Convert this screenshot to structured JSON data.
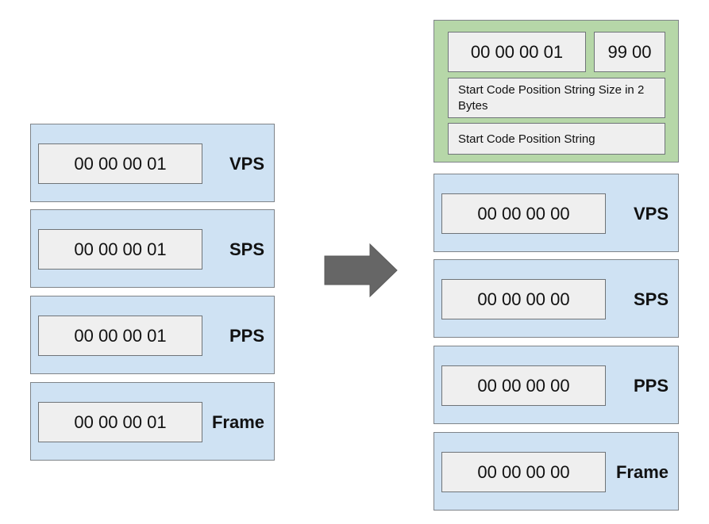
{
  "before": {
    "units": [
      {
        "start_code": "00 00 00 01",
        "label": "VPS"
      },
      {
        "start_code": "00 00 00 01",
        "label": "SPS"
      },
      {
        "start_code": "00 00 00 01",
        "label": "PPS"
      },
      {
        "start_code": "00 00 00 01",
        "label": "Frame"
      }
    ]
  },
  "arrow": {
    "icon": "right-arrow-icon",
    "color": "#666666"
  },
  "after": {
    "header": {
      "start_code": "00 00 00 01",
      "marker": "99 00",
      "size_field": "Start Code Position String Size in 2 Bytes",
      "position_string": "Start Code Position String",
      "color": "#b6d7a8"
    },
    "units": [
      {
        "start_code": "00 00 00 00",
        "label": "VPS"
      },
      {
        "start_code": "00 00 00 00",
        "label": "SPS"
      },
      {
        "start_code": "00 00 00 00",
        "label": "PPS"
      },
      {
        "start_code": "00 00 00 00",
        "label": "Frame"
      }
    ]
  },
  "colors": {
    "unit_bg": "#cfe2f3",
    "code_bg": "#efefef"
  }
}
